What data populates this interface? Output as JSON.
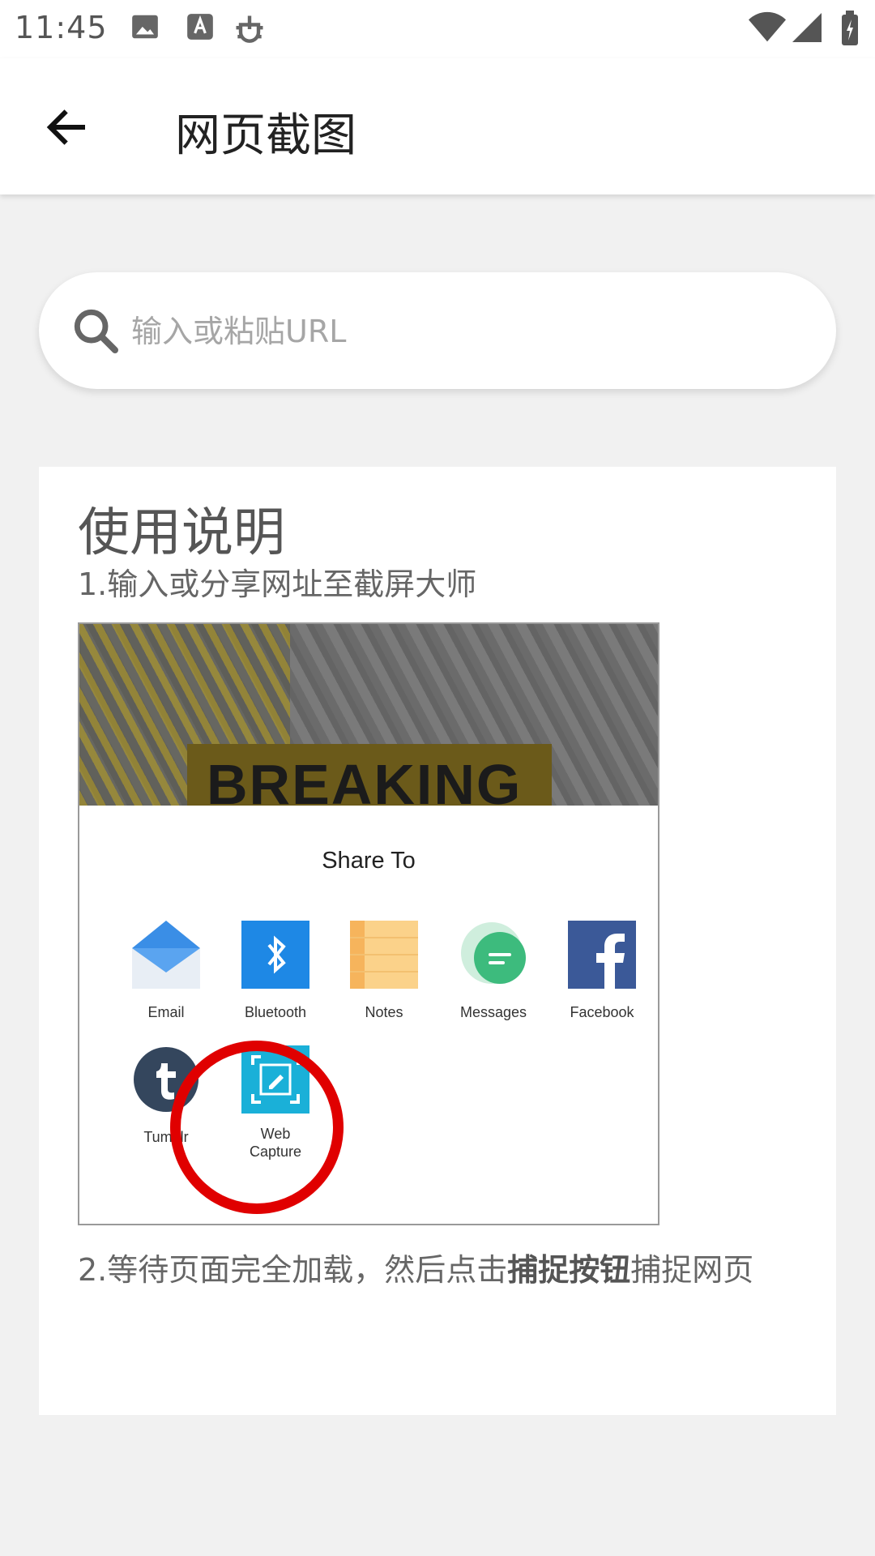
{
  "status": {
    "time": "11:45"
  },
  "appbar": {
    "title": "网页截图"
  },
  "search": {
    "placeholder": "输入或粘贴URL"
  },
  "instructions": {
    "title": "使用说明",
    "step1": "1.输入或分享网址至截屏大师",
    "step2_before": "2.等待页面完全加载，然后点击",
    "step2_bold": "捕捉按钮",
    "step2_after": "捕捉网页"
  },
  "figure": {
    "banner_text": "BREAKING",
    "share_title": "Share To",
    "apps": [
      "Email",
      "Bluetooth",
      "Notes",
      "Messages",
      "Facebook",
      "Tumblr",
      "Web Capture"
    ]
  },
  "colors": {
    "accent_circle": "#e00000",
    "bluetooth": "#1e88e5",
    "facebook": "#3b5998",
    "messages": "#3dbb7d",
    "web_capture": "#1ab0d8"
  }
}
